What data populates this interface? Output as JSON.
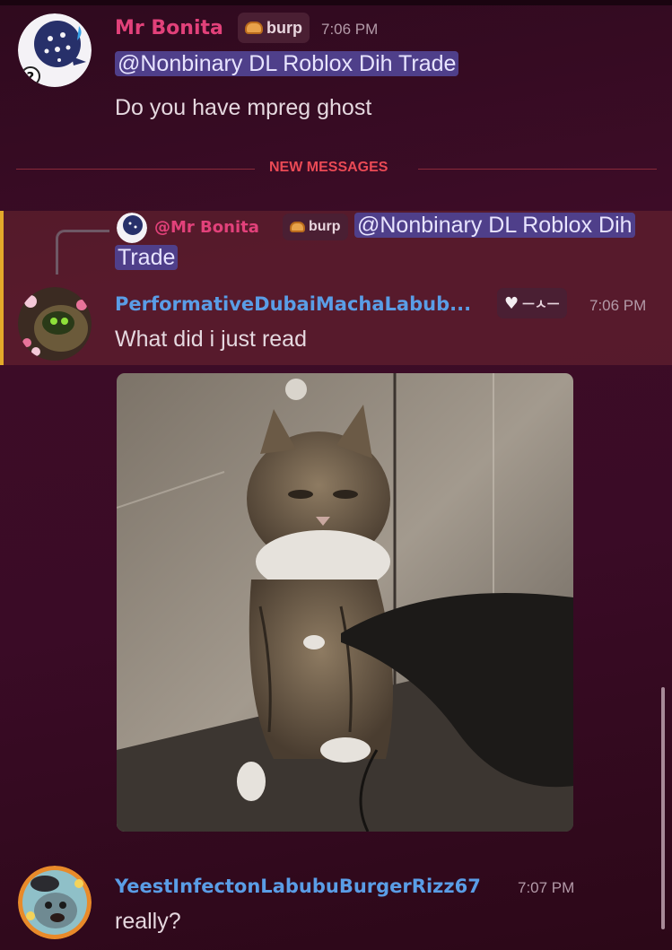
{
  "colors": {
    "background": "#3a0b26",
    "new_messages_red": "#ea4a55",
    "mention_bg": "#4f3f8a",
    "highlight_bar": "#e3a92a",
    "mr_bonita_name": "#e2417a",
    "blue_name": "#5a9de6"
  },
  "messages": [
    {
      "author": "Mr Bonita",
      "tag": "burp",
      "tag_icon": "bread-icon",
      "timestamp": "7:06 PM",
      "mention": "@Nonbinary DL Roblox Dih Trade",
      "text": "Do you have mpreg ghost"
    },
    {
      "reply_to": {
        "author": "@Mr Bonita",
        "tag": "burp",
        "mention_line1": "@Nonbinary DL Roblox Dih",
        "mention_line2": "Trade"
      },
      "author": "PerformativeDubaiMachaLabub...",
      "tag": "ㅡㅅㅡ",
      "tag_icon": "white-heart-icon",
      "timestamp": "7:06 PM",
      "text": "What did i just read",
      "attachment": "cat-photo"
    },
    {
      "author": "YeestInfectonLabubuBurgerRizz67",
      "timestamp": "7:07 PM",
      "text": "really?"
    }
  ],
  "divider": {
    "label": "NEW MESSAGES"
  }
}
